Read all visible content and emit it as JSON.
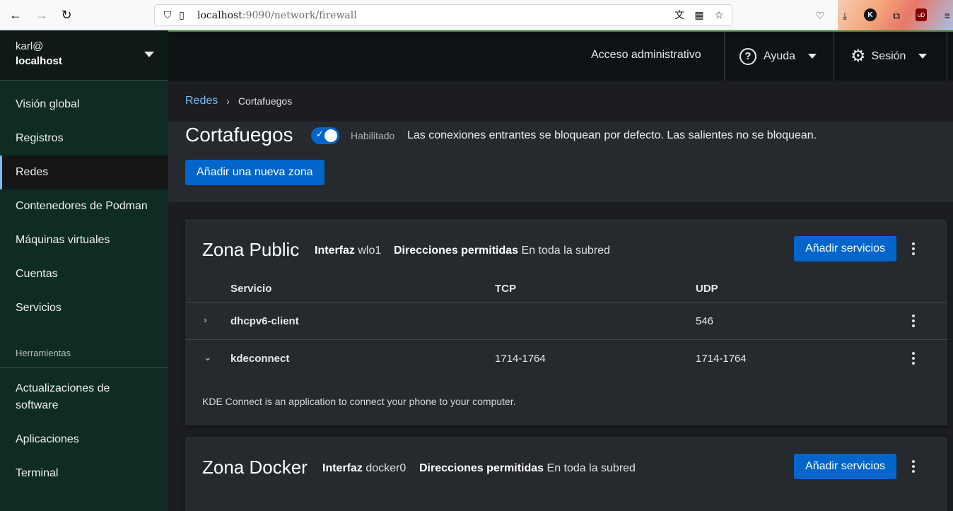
{
  "browser": {
    "url_host": "localhost",
    "url_path": ":9090/network/firewall"
  },
  "host": {
    "user": "karl@",
    "machine": "localhost"
  },
  "sidebar": {
    "items": [
      {
        "label": "Visión global"
      },
      {
        "label": "Registros"
      },
      {
        "label": "Redes"
      },
      {
        "label": "Contenedores de Podman"
      },
      {
        "label": "Máquinas virtuales"
      },
      {
        "label": "Cuentas"
      },
      {
        "label": "Servicios"
      }
    ],
    "tools_heading": "Herramientas",
    "tools": [
      {
        "label": "Actualizaciones de software"
      },
      {
        "label": "Aplicaciones"
      },
      {
        "label": "Terminal"
      }
    ]
  },
  "topbar": {
    "admin": "Acceso administrativo",
    "help": "Ayuda",
    "session": "Sesión"
  },
  "breadcrumb": {
    "parent": "Redes",
    "current": "Cortafuegos"
  },
  "firewall": {
    "title": "Cortafuegos",
    "status": "Habilitado",
    "enabled": true,
    "description": "Las conexiones entrantes se bloquean por defecto. Las salientes no se bloquean.",
    "add_zone": "Añadir una nueva zona"
  },
  "zones": [
    {
      "title": "Zona Public",
      "interface_label": "Interfaz",
      "interface": "wlo1",
      "allowed_label": "Direcciones permitidas",
      "allowed": "En toda la subred",
      "add_services": "Añadir servicios",
      "columns": [
        "Servicio",
        "TCP",
        "UDP"
      ],
      "services": [
        {
          "name": "dhcpv6-client",
          "tcp": "",
          "udp": "546",
          "expanded": false
        },
        {
          "name": "kdeconnect",
          "tcp": "1714-1764",
          "udp": "1714-1764",
          "expanded": true,
          "description": "KDE Connect is an application to connect your phone to your computer."
        }
      ]
    },
    {
      "title": "Zona Docker",
      "interface_label": "Interfaz",
      "interface": "docker0",
      "allowed_label": "Direcciones permitidas",
      "allowed": "En toda la subred",
      "add_services": "Añadir servicios"
    }
  ]
}
